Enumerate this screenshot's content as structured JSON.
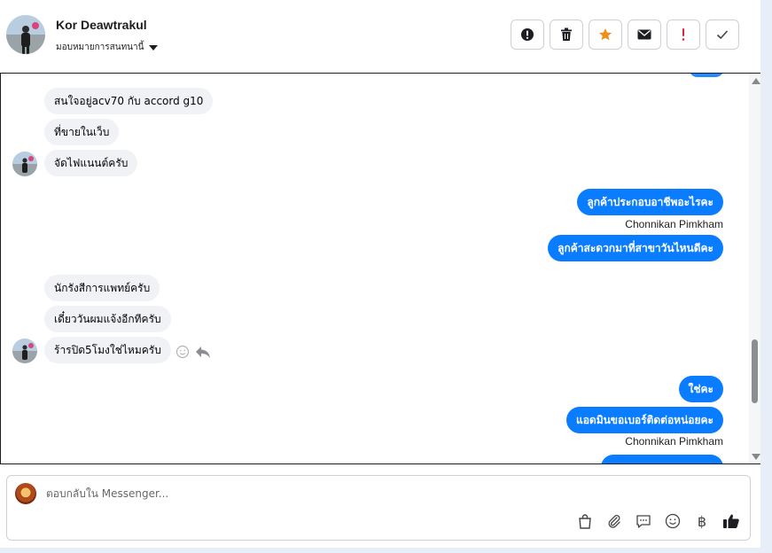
{
  "header": {
    "contact_name": "Kor Deawtrakul",
    "assign_label": "มอบหมายการสนทนานี้",
    "toolbar": [
      {
        "name": "spam-button",
        "icon": "alert-circle-icon"
      },
      {
        "name": "delete-button",
        "icon": "trash-icon"
      },
      {
        "name": "star-button",
        "icon": "star-icon"
      },
      {
        "name": "mark-unread-button",
        "icon": "envelope-icon"
      },
      {
        "name": "follow-up-button",
        "icon": "exclamation-icon"
      },
      {
        "name": "mark-done-button",
        "icon": "check-icon"
      }
    ]
  },
  "messages": [
    {
      "dir": "in",
      "text": "สนใจอยู่acv70 กับ accord g10"
    },
    {
      "dir": "in",
      "text": "ที่ขายในเว็บ"
    },
    {
      "dir": "in",
      "text": "จัดไฟแนนต์ครับ"
    },
    {
      "dir": "out",
      "text": "ลูกค้าประกอบอาชีพอะไรคะ"
    },
    {
      "dir": "sender",
      "text": "Chonnikan Pimkham"
    },
    {
      "dir": "out",
      "text": "ลูกค้าสะดวกมาที่สาขาวันไหนดีคะ"
    },
    {
      "dir": "in",
      "text": "นักรังสีการแพทย์ครับ"
    },
    {
      "dir": "in",
      "text": "เดี๋ยววันผมแจ้งอีกทีครับ"
    },
    {
      "dir": "in",
      "text": "ร้ารปิด5โมงใช่ไหมครับ"
    },
    {
      "dir": "out",
      "text": "ใช่คะ"
    },
    {
      "dir": "out",
      "text": "แอดมินขอเบอร์ติดต่อหน่อยคะ"
    },
    {
      "dir": "sender",
      "text": "Chonnikan Pimkham"
    }
  ],
  "composer": {
    "placeholder": "ตอบกลับใน Messenger...",
    "tools": [
      "shopping-bag-icon",
      "paperclip-icon",
      "quick-reply-icon",
      "emoji-icon",
      "baht-icon",
      "thumbs-up-icon"
    ],
    "baht_symbol": "฿"
  },
  "colors": {
    "outgoing_bubble": "#0a7cff",
    "incoming_bubble": "#f0f2f5",
    "star": "#f28c1b",
    "follow_up": "#e41e3f"
  }
}
